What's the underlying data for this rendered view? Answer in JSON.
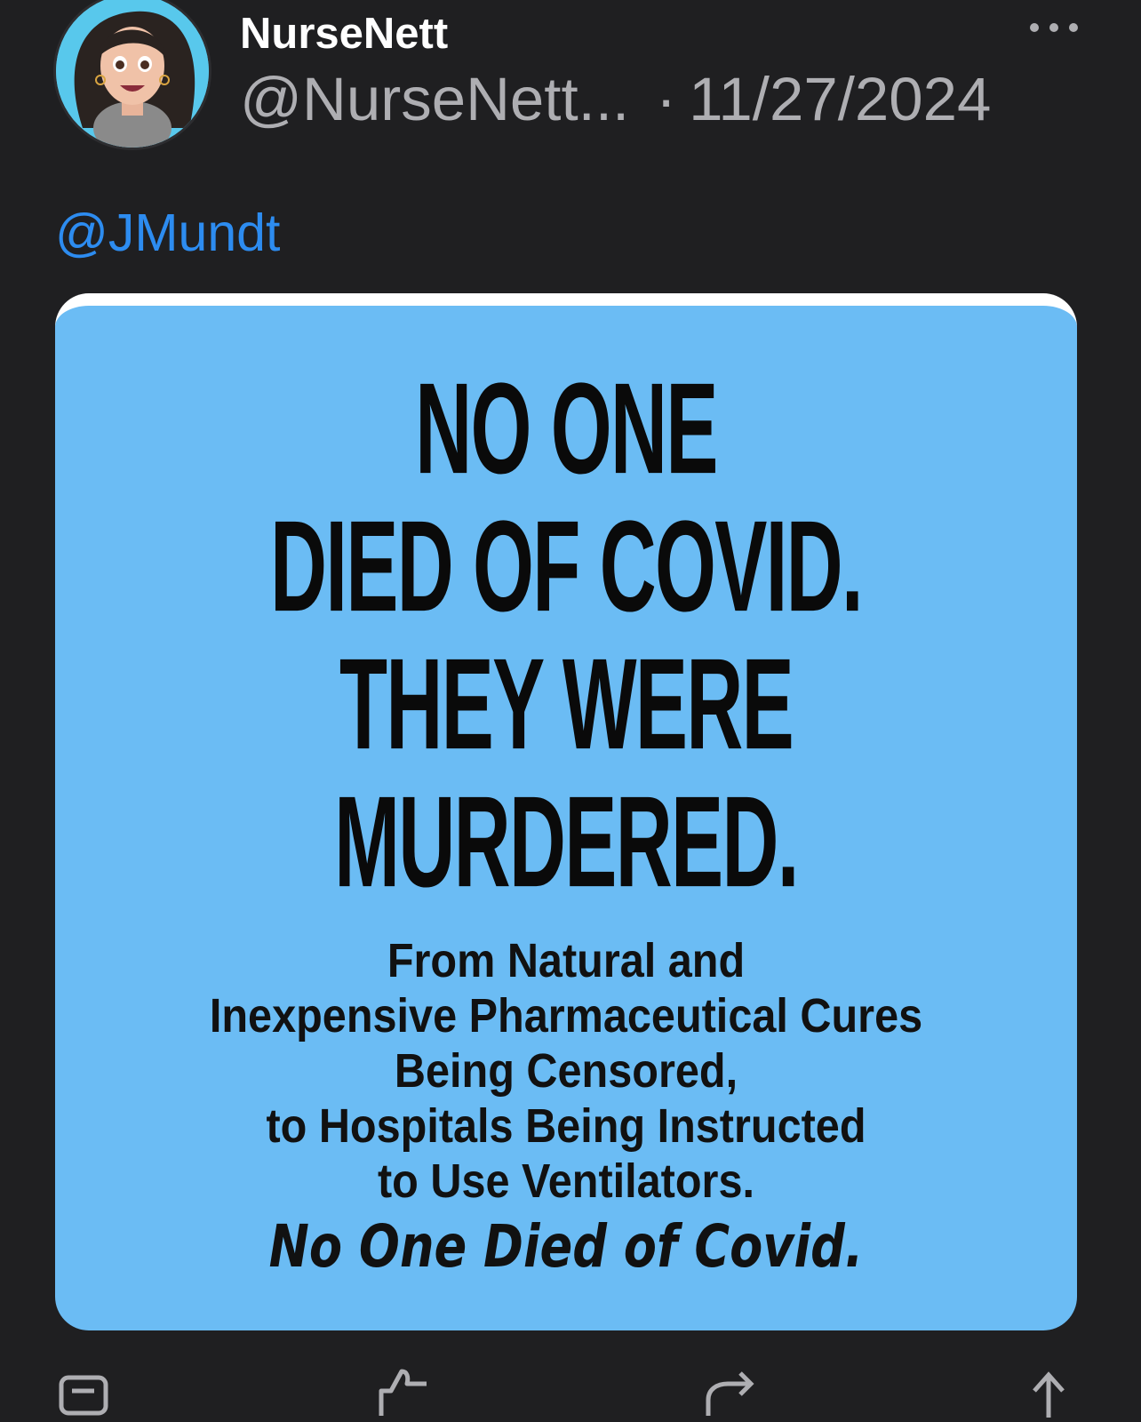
{
  "post": {
    "display_name": "NurseNett",
    "handle": "@NurseNett...",
    "separator": "·",
    "date": "11/27/2024",
    "mention": "@JMundt"
  },
  "image_text": {
    "headline": [
      "NO ONE",
      "DIED OF COVID.",
      "THEY WERE",
      "MURDERED."
    ],
    "body": [
      "From Natural and",
      "Inexpensive Pharmaceutical Cures",
      "Being Censored,",
      "to Hospitals Being Instructed",
      "to Use Ventilators."
    ],
    "tagline": "No One Died of Covid."
  },
  "icons": {
    "more": "more-horizontal-icon",
    "reply": "reply-icon",
    "like": "thumbs-up-icon",
    "share": "share-icon",
    "upload": "upload-icon"
  },
  "colors": {
    "background": "#1f1f21",
    "mention": "#2d8cf0",
    "image_bg": "#6bbcf4"
  }
}
